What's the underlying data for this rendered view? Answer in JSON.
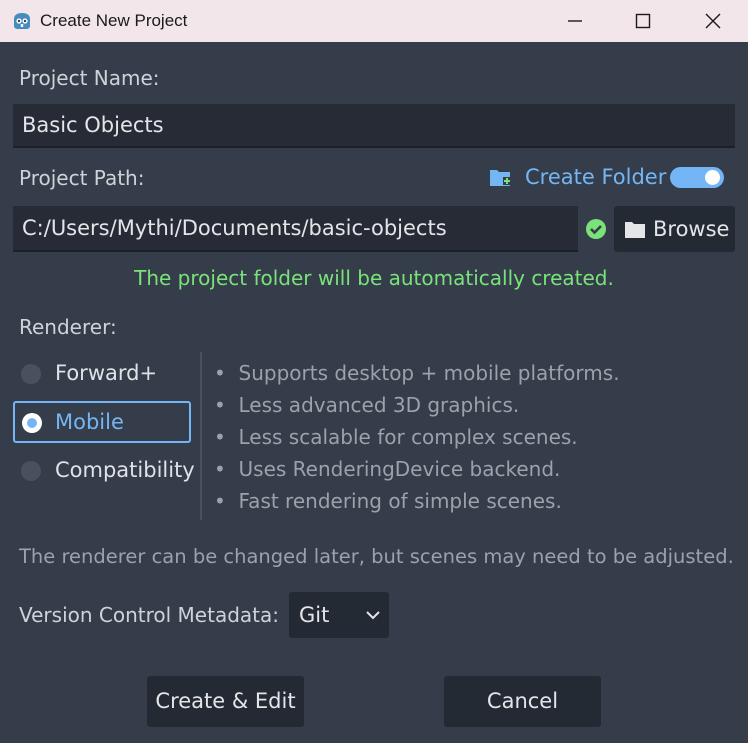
{
  "window": {
    "title": "Create New Project"
  },
  "project_name": {
    "label": "Project Name:",
    "value": "Basic Objects"
  },
  "project_path": {
    "label": "Project Path:",
    "create_folder_label": "Create Folder",
    "create_folder_on": true,
    "value": "C:/Users/Mythi/Documents/basic-objects",
    "browse_label": "Browse",
    "status_message": "The project folder will be automatically created."
  },
  "renderer": {
    "label": "Renderer:",
    "options": [
      "Forward+",
      "Mobile",
      "Compatibility"
    ],
    "selected": "Mobile",
    "features": [
      "Supports desktop + mobile platforms.",
      "Less advanced 3D graphics.",
      "Less scalable for complex scenes.",
      "Uses RenderingDevice backend.",
      "Fast rendering of simple scenes."
    ],
    "note": "The renderer can be changed later, but scenes may need to be adjusted."
  },
  "version_control": {
    "label": "Version Control Metadata:",
    "value": "Git"
  },
  "actions": {
    "create_label": "Create & Edit",
    "cancel_label": "Cancel"
  },
  "colors": {
    "accent": "#74b6f5",
    "success": "#79e37a",
    "background": "#363d4a"
  }
}
